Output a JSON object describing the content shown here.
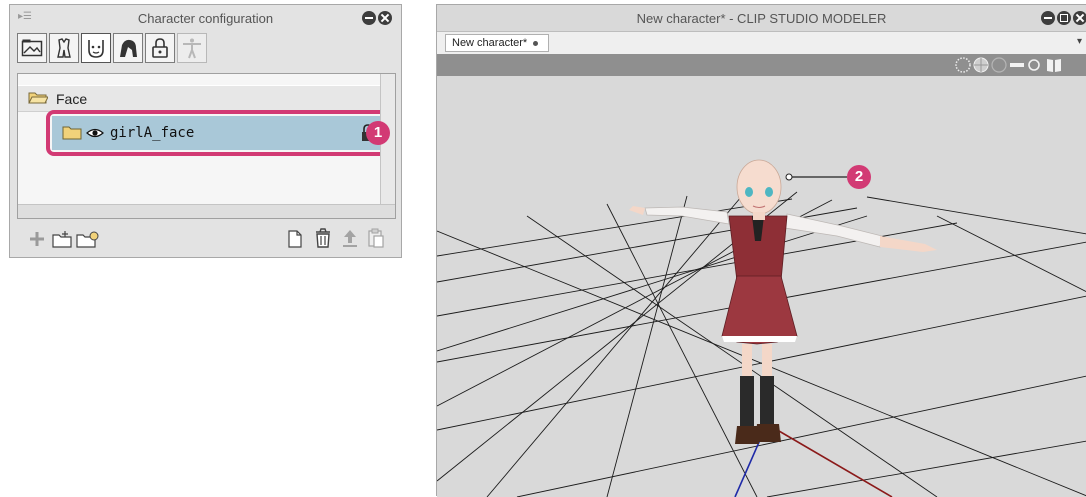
{
  "panel": {
    "title": "Character configuration",
    "tabs": [
      {
        "icon": "scene-icon"
      },
      {
        "icon": "costume-icon"
      },
      {
        "icon": "face-icon"
      },
      {
        "icon": "hair-icon"
      },
      {
        "icon": "accessory-icon"
      },
      {
        "icon": "body-figure-icon"
      }
    ],
    "tree": {
      "folder_label": "Face",
      "selected_item_label": "girlA_face",
      "callout_number": "1"
    },
    "bottom_toolbar": [
      "add-icon",
      "new-folder-icon",
      "folder-load-icon",
      "new-layer-icon",
      "delete-icon",
      "upload-icon",
      "paste-icon"
    ]
  },
  "window": {
    "title": "New character* - CLIP STUDIO MODELER",
    "document_tab_label": "New character*",
    "callout_number": "2"
  },
  "colors": {
    "callout": "#d23a74",
    "selected_row": "#a9c8d8",
    "panel_bg": "#e3e3e3",
    "viewport_bg": "#d9d9d9"
  }
}
